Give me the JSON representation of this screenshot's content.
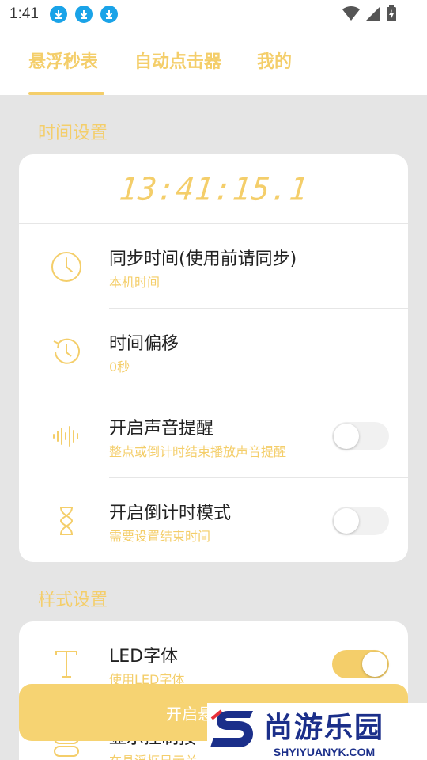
{
  "status_bar": {
    "time": "1:41",
    "download_icons": [
      "download-icon",
      "download-icon",
      "download-icon"
    ],
    "right_icons": [
      "wifi-icon",
      "signal-icon",
      "battery-charging-icon"
    ]
  },
  "tabs": [
    {
      "label": "悬浮秒表",
      "active": true
    },
    {
      "label": "自动点击器",
      "active": false
    },
    {
      "label": "我的",
      "active": false
    }
  ],
  "time_section": {
    "title": "时间设置",
    "clock": "13:41:15.1",
    "rows": [
      {
        "icon": "clock-icon",
        "title": "同步时间(使用前请同步)",
        "subtitle": "本机时间",
        "toggle": null
      },
      {
        "icon": "history-icon",
        "title": "时间偏移",
        "subtitle": "0秒",
        "toggle": null
      },
      {
        "icon": "sound-wave-icon",
        "title": "开启声音提醒",
        "subtitle": "整点或倒计时结束播放声音提醒",
        "toggle": false
      },
      {
        "icon": "hourglass-icon",
        "title": "开启倒计时模式",
        "subtitle": "需要设置结束时间",
        "toggle": false
      }
    ]
  },
  "style_section": {
    "title": "样式设置",
    "rows": [
      {
        "icon": "font-icon",
        "title": "LED字体",
        "subtitle": "使用LED字体",
        "toggle": true
      },
      {
        "icon": "toggle-control-icon",
        "title": "显示控制按",
        "subtitle": "在悬浮框显示关",
        "toggle": null
      }
    ]
  },
  "bottom_button": {
    "label": "开启悬"
  },
  "watermark": {
    "main": "尚游乐园",
    "sub": "SHYIYUANYK.COM"
  },
  "colors": {
    "accent": "#f4ce6a",
    "background": "#e5e5e5",
    "watermark": "#1b2f8a"
  }
}
